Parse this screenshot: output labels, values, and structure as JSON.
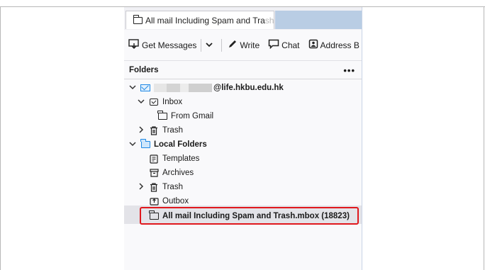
{
  "tab": {
    "title": "All mail Including Spam and Tra",
    "title_fade": "sh"
  },
  "toolbar": {
    "get_messages": "Get Messages",
    "write": "Write",
    "chat": "Chat",
    "address_book": "Address B"
  },
  "folders_pane": {
    "header": "Folders",
    "more_label": "•••"
  },
  "tree": {
    "account": {
      "email_suffix": "@life.hkbu.edu.hk",
      "email_prefix_redacted": true
    },
    "inbox": "Inbox",
    "from_gmail": "From Gmail",
    "trash": "Trash",
    "local_folders": "Local Folders",
    "templates": "Templates",
    "archives": "Archives",
    "local_trash": "Trash",
    "outbox": "Outbox",
    "imported": "All mail Including Spam and Trash.mbox (18823)"
  },
  "colors": {
    "accent": "#1e88e5",
    "highlight_border": "#e0181d",
    "tab_space": "#b9cde4"
  }
}
